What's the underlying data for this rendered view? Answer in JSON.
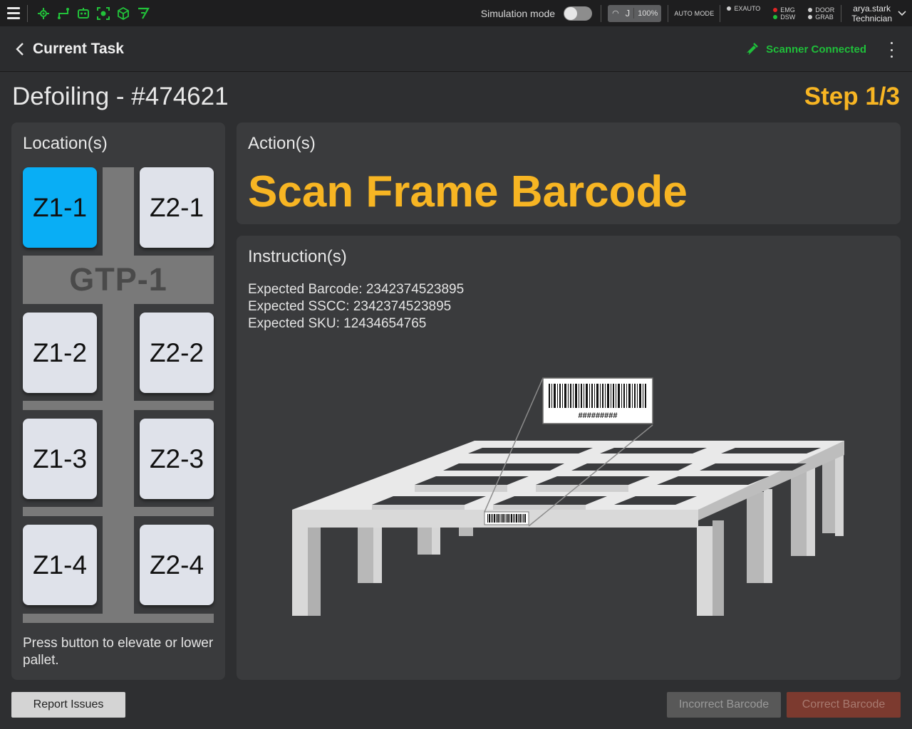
{
  "topbar": {
    "menu_icon": "hamburger-icon",
    "tool_icons": [
      "move-icon",
      "path-icon",
      "robot-icon",
      "target-icon",
      "cube-icon",
      "wand-icon"
    ],
    "simulation_label": "Simulation mode",
    "simulation_on": false,
    "speed_icon": "gauge-icon",
    "speed_mode": "J",
    "speed_value": "100%",
    "auto_mode": "AUTO MODE",
    "status": {
      "exauto": "EXAUTO",
      "emg": "EMG",
      "dsw": "DSW",
      "door": "DOOR",
      "grab": "GRAB"
    },
    "status_colors": {
      "exauto": "#cfcfcf",
      "emg": "#e02525",
      "dsw": "#1fbf3a",
      "door": "#cfcfcf",
      "grab": "#cfcfcf"
    },
    "user_name": "arya.stark",
    "user_role": "Technician"
  },
  "header": {
    "title": "Current Task",
    "scanner_status": "Scanner Connected",
    "scanner_color": "#1fbf3a"
  },
  "task": {
    "title": "Defoiling - #474621",
    "step": "Step 1/3"
  },
  "locations": {
    "title": "Location(s)",
    "station": "GTP-1",
    "zones": [
      {
        "label": "Z1-1",
        "active": true
      },
      {
        "label": "Z2-1",
        "active": false
      },
      {
        "label": "Z1-2",
        "active": false
      },
      {
        "label": "Z2-2",
        "active": false
      },
      {
        "label": "Z1-3",
        "active": false
      },
      {
        "label": "Z2-3",
        "active": false
      },
      {
        "label": "Z1-4",
        "active": false
      },
      {
        "label": "Z2-4",
        "active": false
      }
    ],
    "note": "Press button to elevate or lower pallet.",
    "active_color": "#09aef5"
  },
  "actions": {
    "title": "Action(s)",
    "action": "Scan Frame Barcode",
    "action_color": "#f7b523"
  },
  "instructions": {
    "title": "Instruction(s)",
    "lines": [
      "Expected Barcode: 2342374523895",
      "Expected SSCC: 2342374523895",
      "Expected SKU: 12434654765"
    ],
    "barcode_label_text": "#########"
  },
  "footer": {
    "report_label": "Report Issues",
    "incorrect_label": "Incorrect Barcode",
    "correct_label": "Correct Barcode"
  }
}
